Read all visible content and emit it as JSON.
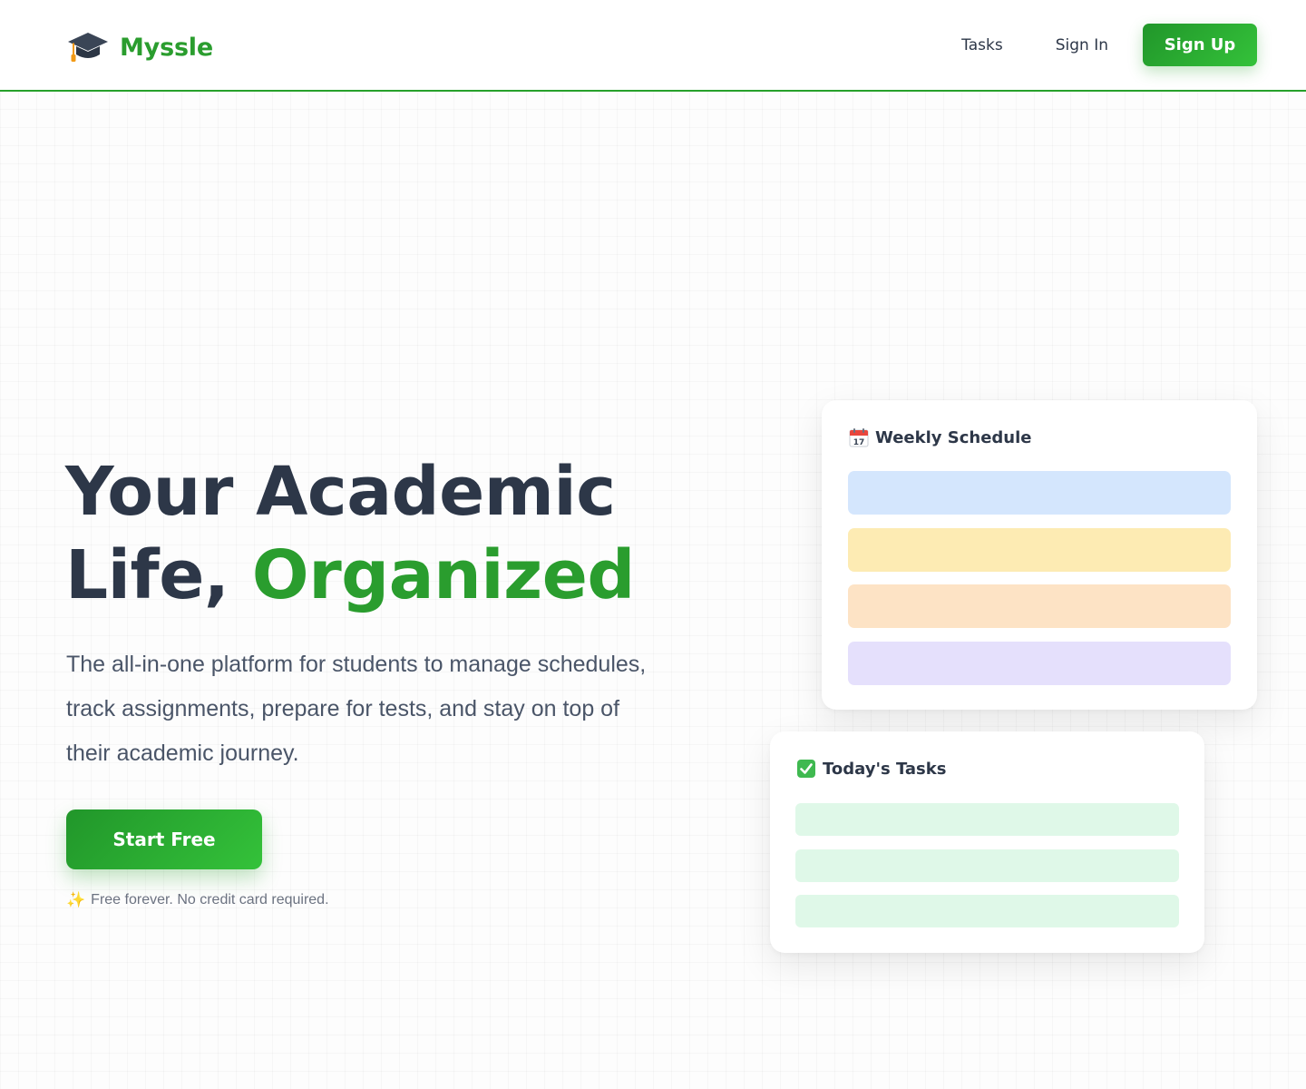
{
  "brand": {
    "name": "Myssle",
    "color": "#2a9d2e",
    "icon": "graduation-cap-icon"
  },
  "nav": {
    "tasks": "Tasks",
    "signin": "Sign In",
    "signup": "Sign Up"
  },
  "hero": {
    "title_line1": "Your Academic",
    "title_line2_prefix": "Life, ",
    "title_accent": "Organized",
    "subtitle": "The all-in-one platform for students to manage schedules, track assignments, prepare for tests, and stay on top of their academic journey.",
    "cta": "Start Free",
    "note": "Free forever. No credit card required.",
    "note_icon": "sparkles-icon"
  },
  "cards": {
    "schedule": {
      "title": "Weekly Schedule",
      "icon": "calendar-icon",
      "bar_colors": [
        "#d4e6fd",
        "#fdebb3",
        "#fde3c5",
        "#e5e0fc"
      ]
    },
    "tasks": {
      "title": "Today's Tasks",
      "icon": "checkmark-icon",
      "bar_colors": [
        "#dff8e8",
        "#dff8e8",
        "#dff8e8"
      ]
    }
  }
}
